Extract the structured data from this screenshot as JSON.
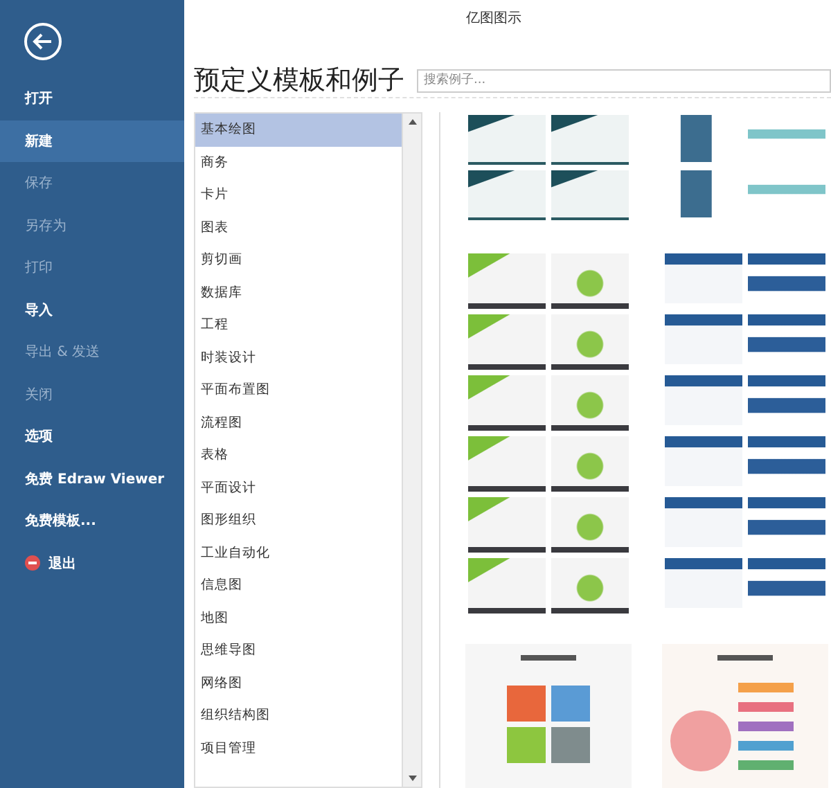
{
  "window": {
    "title": "亿图图示"
  },
  "sidebar": {
    "items": [
      {
        "label": "打开",
        "kind": "plain",
        "disabled": false,
        "selected": false
      },
      {
        "label": "新建",
        "kind": "plain",
        "disabled": false,
        "selected": true
      },
      {
        "label": "保存",
        "kind": "plain",
        "disabled": true,
        "selected": false
      },
      {
        "label": "另存为",
        "kind": "plain",
        "disabled": true,
        "selected": false
      },
      {
        "label": "打印",
        "kind": "plain",
        "disabled": true,
        "selected": false
      },
      {
        "label": "导入",
        "kind": "plain",
        "disabled": false,
        "selected": false
      },
      {
        "label": "导出 & 发送",
        "kind": "plain",
        "disabled": true,
        "selected": false
      },
      {
        "label": "关闭",
        "kind": "plain",
        "disabled": true,
        "selected": false
      },
      {
        "label": "选项",
        "kind": "plain",
        "disabled": false,
        "selected": false
      },
      {
        "label": "免费 Edraw Viewer",
        "kind": "plain",
        "disabled": false,
        "selected": false
      },
      {
        "label": "免费模板...",
        "kind": "plain",
        "disabled": false,
        "selected": false
      },
      {
        "label": "退出",
        "kind": "exit",
        "disabled": false,
        "selected": false
      }
    ]
  },
  "heading": "预定义模板和例子",
  "search": {
    "placeholder": "搜索例子..."
  },
  "categories": [
    {
      "label": "基本绘图",
      "selected": true
    },
    {
      "label": "商务",
      "selected": false
    },
    {
      "label": "卡片",
      "selected": false
    },
    {
      "label": "图表",
      "selected": false
    },
    {
      "label": "剪切画",
      "selected": false
    },
    {
      "label": "数据库",
      "selected": false
    },
    {
      "label": "工程",
      "selected": false
    },
    {
      "label": "时装设计",
      "selected": false
    },
    {
      "label": "平面布置图",
      "selected": false
    },
    {
      "label": "流程图",
      "selected": false
    },
    {
      "label": "表格",
      "selected": false
    },
    {
      "label": "平面设计",
      "selected": false
    },
    {
      "label": "图形组织",
      "selected": false
    },
    {
      "label": "工业自动化",
      "selected": false
    },
    {
      "label": "信息图",
      "selected": false
    },
    {
      "label": "地图",
      "selected": false
    },
    {
      "label": "思维导图",
      "selected": false
    },
    {
      "label": "网络图",
      "selected": false
    },
    {
      "label": "组织结构图",
      "selected": false
    },
    {
      "label": "项目管理",
      "selected": false
    }
  ],
  "templates": [
    {
      "kind": "teal-deck"
    },
    {
      "kind": "teal-infographic"
    },
    {
      "kind": "green-deck"
    },
    {
      "kind": "blue-deck"
    },
    {
      "kind": "cycle-infographic"
    },
    {
      "kind": "flow-infographic"
    }
  ]
}
